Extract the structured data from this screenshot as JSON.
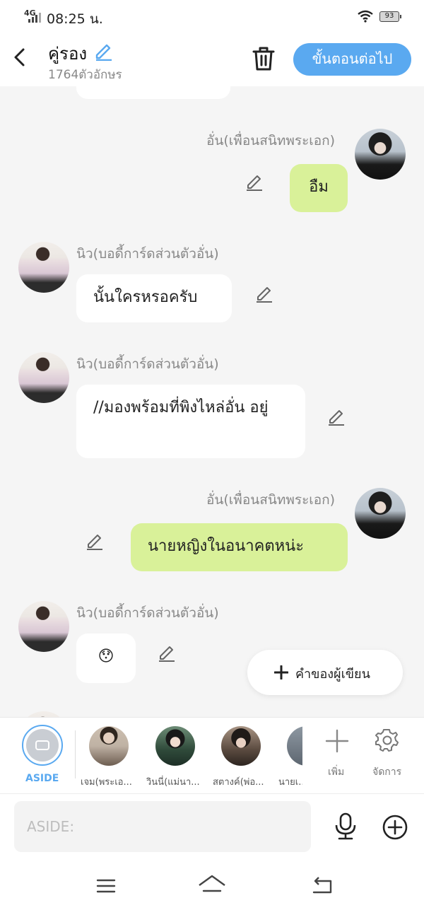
{
  "status_bar": {
    "network": "4G",
    "time": "08:25 น.",
    "battery": "93"
  },
  "header": {
    "title": "คู่รอง",
    "char_count": "1764ตัวอักษร",
    "next_label": "ขั้นตอนต่อไป"
  },
  "messages": [
    {
      "sender": "อั่น(เพื่อนสนิทพระเอก)",
      "text": "อืม",
      "side": "right"
    },
    {
      "sender": "นิว(บอดี้การ์ดส่วนตัวอั่น)",
      "text": "นั้นใครหรอครับ",
      "side": "left"
    },
    {
      "sender": "นิว(บอดี้การ์ดส่วนตัวอั่น)",
      "text": "//มองพร้อมที่พิงไหล่อั่น อยู่",
      "side": "left"
    },
    {
      "sender": "อั่น(เพื่อนสนิทพระเอก)",
      "text": "นายหญิงในอนาคตหน่ะ",
      "side": "right"
    },
    {
      "sender": "นิว(บอดี้การ์ดส่วนตัวอั่น)",
      "text": "😯",
      "side": "left"
    }
  ],
  "fab": {
    "label": "คำของผู้เขียน"
  },
  "characters": {
    "aside_label": "ASIDE",
    "items": [
      {
        "name": "เจม(พระเอ..."
      },
      {
        "name": "วินนี่(แม่นา..."
      },
      {
        "name": "สตางค์(พ่อ..."
      },
      {
        "name": "นายเ..."
      }
    ],
    "add_label": "เพิ่ม",
    "manage_label": "จัดการ"
  },
  "input": {
    "placeholder": "ASIDE:"
  },
  "colors": {
    "accent": "#5aa9f0",
    "green_bubble": "#d9f199",
    "chat_bg": "#f5f5f5"
  }
}
